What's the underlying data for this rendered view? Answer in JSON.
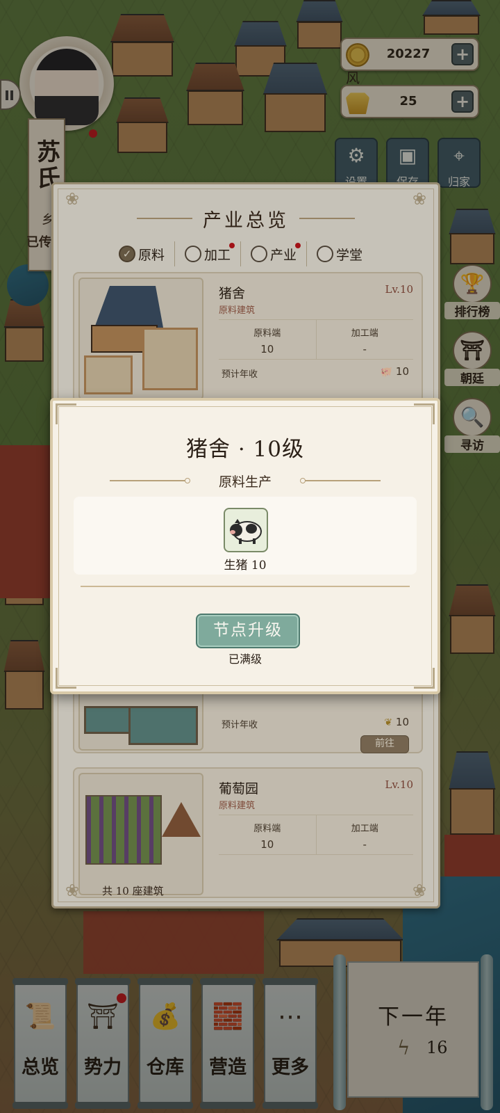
{
  "player": {
    "family_name": "苏氏",
    "banner_partial_1": "乡",
    "banner_partial_2": "已传"
  },
  "resources": {
    "coins": "20227",
    "gold_ingots": "25",
    "plus_label": "+"
  },
  "top_buttons": [
    {
      "label": "设置",
      "icon": "gear-icon"
    },
    {
      "label": "保存",
      "icon": "save-icon"
    },
    {
      "label": "归家",
      "icon": "location-pin-icon"
    }
  ],
  "side_buttons": [
    {
      "label": "排行榜",
      "icon": "trophy-icon"
    },
    {
      "label": "朝廷",
      "icon": "palace-icon"
    },
    {
      "label": "寻访",
      "icon": "magnifier-icon"
    }
  ],
  "map_sign": "风",
  "overview": {
    "title": "产业总览",
    "filters": [
      {
        "label": "原料",
        "checked": true,
        "red_dot": false
      },
      {
        "label": "加工",
        "checked": false,
        "red_dot": true
      },
      {
        "label": "产业",
        "checked": false,
        "red_dot": true
      },
      {
        "label": "学堂",
        "checked": false,
        "red_dot": false
      }
    ],
    "stat_labels": {
      "raw": "原料端",
      "process": "加工端",
      "yield": "预计年收",
      "goto": "前往"
    },
    "buildings": [
      {
        "name": "猪舍",
        "level": "Lv.10",
        "type": "原料建筑",
        "raw": "10",
        "process": "-",
        "yield": "10",
        "yield_icon": "pig-icon"
      },
      {
        "name": "",
        "level": "",
        "type": "",
        "raw": "",
        "process": "",
        "yield": "10",
        "yield_icon": "wheat-icon"
      },
      {
        "name": "葡萄园",
        "level": "Lv.10",
        "type": "原料建筑",
        "raw": "10",
        "process": "-",
        "yield": "",
        "yield_icon": ""
      }
    ],
    "footer": "共 10 座建筑"
  },
  "modal": {
    "title": "猪舍 · 10级",
    "subtitle": "原料生产",
    "item": {
      "name": "生猪 10",
      "icon": "pig-icon"
    },
    "upgrade_button": "节点升级",
    "status": "已满级"
  },
  "bottom_nav": [
    {
      "label": "总览",
      "icon": "scroll-brush-icon",
      "red_dot": false
    },
    {
      "label": "势力",
      "icon": "pavilion-icon",
      "red_dot": true
    },
    {
      "label": "仓库",
      "icon": "treasure-bag-icon",
      "red_dot": false
    },
    {
      "label": "营造",
      "icon": "trowel-bricks-icon",
      "red_dot": false
    },
    {
      "label": "更多",
      "icon": "more-dots-icon",
      "red_dot": false
    }
  ],
  "next_year": {
    "label": "下一年",
    "energy_icon": "lightning-icon",
    "energy": "16"
  },
  "colors": {
    "accent_teal": "#7faa9c",
    "panel_bg": "#f2ece0",
    "level_red": "#8a4a3a",
    "notify_red": "#c4161c"
  }
}
